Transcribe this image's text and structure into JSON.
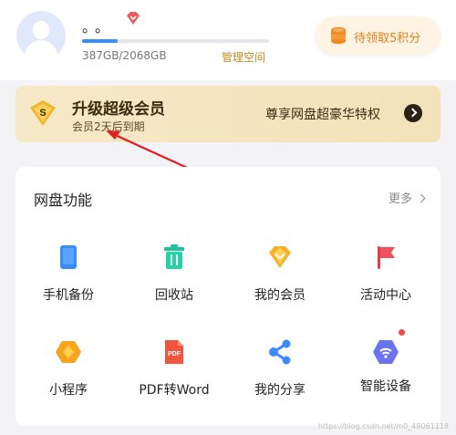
{
  "header": {
    "username": "。。",
    "storage": {
      "used_percent": 19,
      "text": "387GB/2068GB"
    },
    "manage_label": "管理空间",
    "points_label": "待领取5积分",
    "icons": {
      "avatar": "avatar-icon",
      "badge": "diamond-icon",
      "points": "coins-icon"
    }
  },
  "vip": {
    "title": "升级超级会员",
    "subtitle": "会员2天后到期",
    "promo": "尊享网盘超豪华特权",
    "icons": {
      "badge": "super-vip-shield-icon",
      "arrow": "chevron-right-icon"
    }
  },
  "functions": {
    "title": "网盘功能",
    "more_label": "更多",
    "items": [
      {
        "label": "手机备份",
        "icon": "phone-backup-icon"
      },
      {
        "label": "回收站",
        "icon": "recycle-bin-icon"
      },
      {
        "label": "我的会员",
        "icon": "membership-diamond-icon"
      },
      {
        "label": "活动中心",
        "icon": "activity-flag-icon"
      },
      {
        "label": "小程序",
        "icon": "mini-program-icon"
      },
      {
        "label": "PDF转Word",
        "icon": "pdf-convert-icon"
      },
      {
        "label": "我的分享",
        "icon": "share-icon"
      },
      {
        "label": "智能设备",
        "icon": "smart-device-icon",
        "has_red_dot": true
      }
    ]
  },
  "watermark": "https://blog.csdn.net/m0_48061118",
  "colors": {
    "accent_blue": "#3a8bff",
    "gold": "#c58a23",
    "orange": "#e0821a"
  }
}
